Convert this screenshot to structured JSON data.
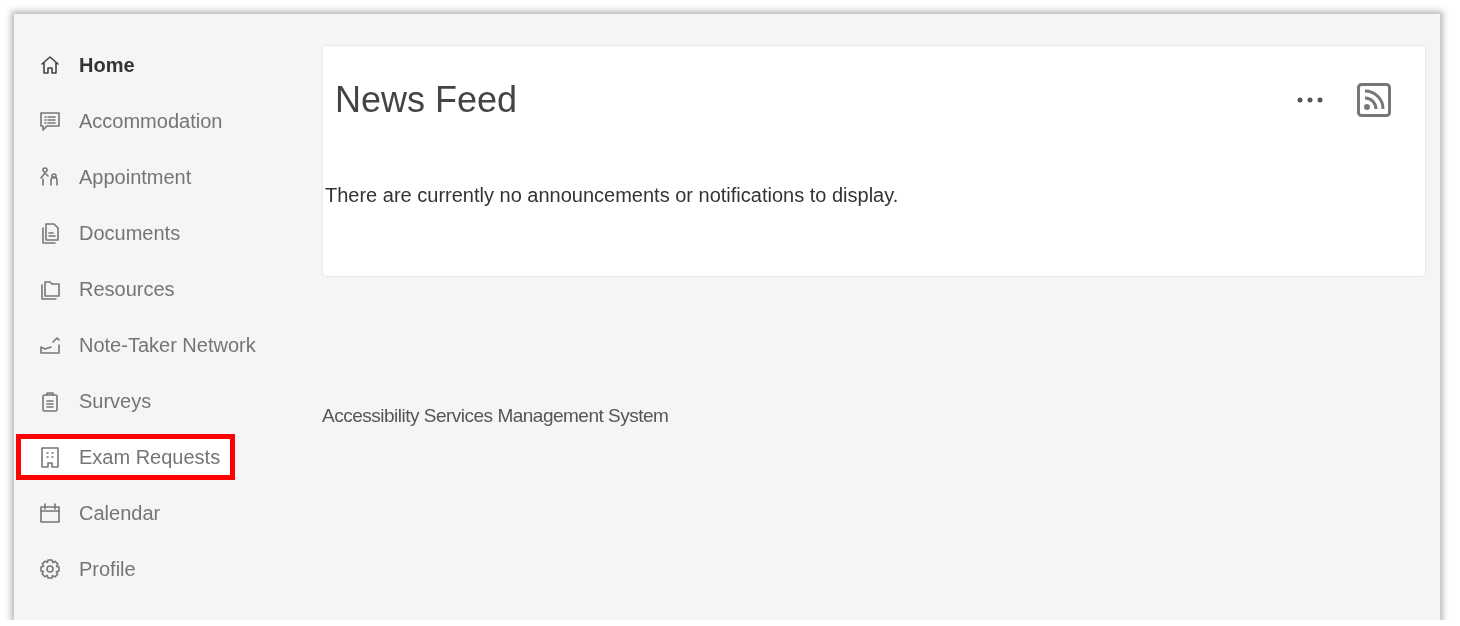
{
  "sidebar": {
    "items": [
      {
        "label": "Home",
        "selected": true,
        "highlighted": false
      },
      {
        "label": "Accommodation",
        "selected": false,
        "highlighted": false
      },
      {
        "label": "Appointment",
        "selected": false,
        "highlighted": false
      },
      {
        "label": "Documents",
        "selected": false,
        "highlighted": false
      },
      {
        "label": "Resources",
        "selected": false,
        "highlighted": false
      },
      {
        "label": "Note-Taker Network",
        "selected": false,
        "highlighted": false
      },
      {
        "label": "Surveys",
        "selected": false,
        "highlighted": false
      },
      {
        "label": "Exam Requests",
        "selected": false,
        "highlighted": true
      },
      {
        "label": "Calendar",
        "selected": false,
        "highlighted": false
      },
      {
        "label": "Profile",
        "selected": false,
        "highlighted": false
      }
    ]
  },
  "news_feed": {
    "title": "News Feed",
    "message": "There are currently no announcements or notifications to display."
  },
  "footer": {
    "text": "Accessibility Services Management System"
  }
}
